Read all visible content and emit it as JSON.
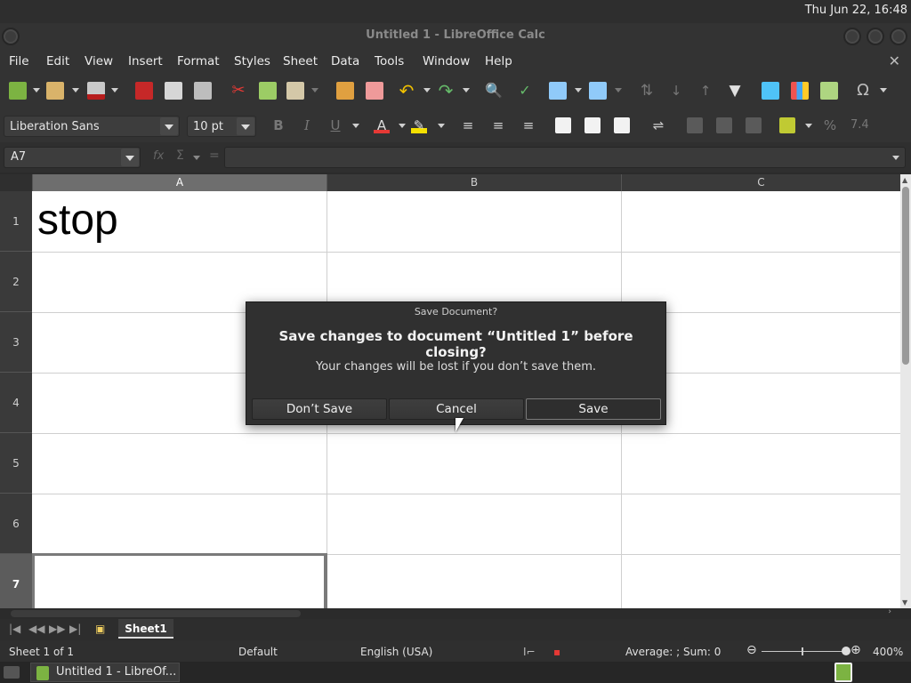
{
  "system": {
    "clock": "Thu Jun 22, 16:48"
  },
  "window": {
    "title": "Untitled 1 - LibreOffice Calc"
  },
  "menu": {
    "items": [
      "File",
      "Edit",
      "View",
      "Insert",
      "Format",
      "Styles",
      "Sheet",
      "Data",
      "Tools",
      "Window",
      "Help"
    ]
  },
  "toolbar2": {
    "font_name": "Liberation Sans",
    "font_size": "10 pt"
  },
  "formula": {
    "name_box": "A7",
    "content": ""
  },
  "grid": {
    "columns": [
      "A",
      "B",
      "C"
    ],
    "rows": [
      "1",
      "2",
      "3",
      "4",
      "5",
      "6",
      "7"
    ],
    "cells": {
      "A1": "stop"
    },
    "selected_cell": "A7"
  },
  "sheets": {
    "tabs": [
      "Sheet1"
    ]
  },
  "status": {
    "sheet_info": "Sheet 1 of 1",
    "page_style": "Default",
    "language": "English (USA)",
    "summary": "Average: ; Sum: 0",
    "zoom": "400%"
  },
  "taskbar": {
    "item_label": "Untitled 1 - LibreOf..."
  },
  "dialog": {
    "title": "Save Document?",
    "heading": "Save changes to document “Untitled 1” before closing?",
    "message": "Your changes will be lost if you don’t save them.",
    "buttons": {
      "dont_save": "Don’t Save",
      "cancel": "Cancel",
      "save": "Save"
    }
  },
  "colors": {
    "accent_green": "#8bc34a",
    "font_color_red": "#e53935",
    "highlight_yellow": "#f5e000"
  }
}
